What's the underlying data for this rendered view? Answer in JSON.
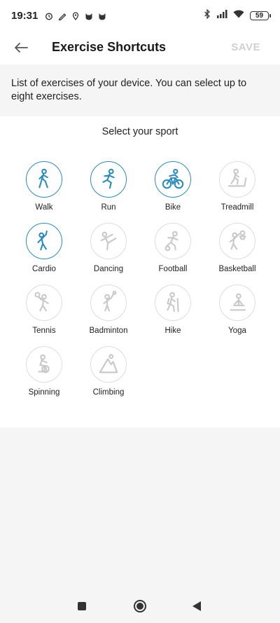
{
  "status_bar": {
    "time": "19:31",
    "battery": "59"
  },
  "app_bar": {
    "title": "Exercise Shortcuts",
    "save_label": "SAVE"
  },
  "description": "List of exercises of your device. You can select up to eight exercises.",
  "sport_section": {
    "heading": "Select your sport",
    "accent_color": "#2a8bbf",
    "inactive_color": "#c8c8c8",
    "sports": [
      {
        "label": "Walk",
        "icon": "walk-icon",
        "selected": true
      },
      {
        "label": "Run",
        "icon": "run-icon",
        "selected": true
      },
      {
        "label": "Bike",
        "icon": "bike-icon",
        "selected": true
      },
      {
        "label": "Treadmill",
        "icon": "treadmill-icon",
        "selected": false
      },
      {
        "label": "Cardio",
        "icon": "cardio-icon",
        "selected": true
      },
      {
        "label": "Dancing",
        "icon": "dancing-icon",
        "selected": false
      },
      {
        "label": "Football",
        "icon": "football-icon",
        "selected": false
      },
      {
        "label": "Basketball",
        "icon": "basketball-icon",
        "selected": false
      },
      {
        "label": "Tennis",
        "icon": "tennis-icon",
        "selected": false
      },
      {
        "label": "Badminton",
        "icon": "badminton-icon",
        "selected": false
      },
      {
        "label": "Hike",
        "icon": "hike-icon",
        "selected": false
      },
      {
        "label": "Yoga",
        "icon": "yoga-icon",
        "selected": false
      },
      {
        "label": "Spinning",
        "icon": "spinning-icon",
        "selected": false
      },
      {
        "label": "Climbing",
        "icon": "climbing-icon",
        "selected": false
      }
    ]
  }
}
